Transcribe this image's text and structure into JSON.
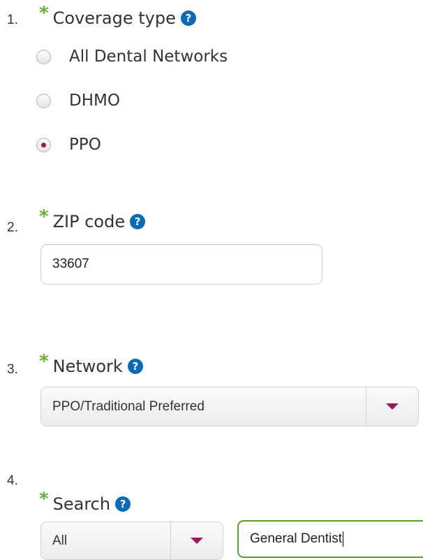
{
  "steps": {
    "coverage": {
      "number": "1.",
      "asterisk": "*",
      "label": "Coverage type",
      "help": "?",
      "options": [
        "All Dental Networks",
        "DHMO",
        "PPO"
      ],
      "selected": "PPO"
    },
    "zip": {
      "number": "2.",
      "asterisk": "*",
      "label": "ZIP code",
      "help": "?",
      "value": "33607"
    },
    "network": {
      "number": "3.",
      "asterisk": "*",
      "label": "Network",
      "help": "?",
      "selected": "PPO/Traditional Preferred"
    },
    "search": {
      "number": "4.",
      "asterisk": "*",
      "label": "Search",
      "help": "?",
      "type_selected": "All",
      "query": "General Dentist"
    }
  },
  "colors": {
    "asterisk": "#68b030",
    "help_icon": "#0a6ab6",
    "accent": "#a0175b",
    "focus_border": "#5aa02a"
  },
  "icons": {
    "help": "question-circle-icon",
    "dropdown": "caret-down-icon",
    "required": "asterisk-icon"
  }
}
